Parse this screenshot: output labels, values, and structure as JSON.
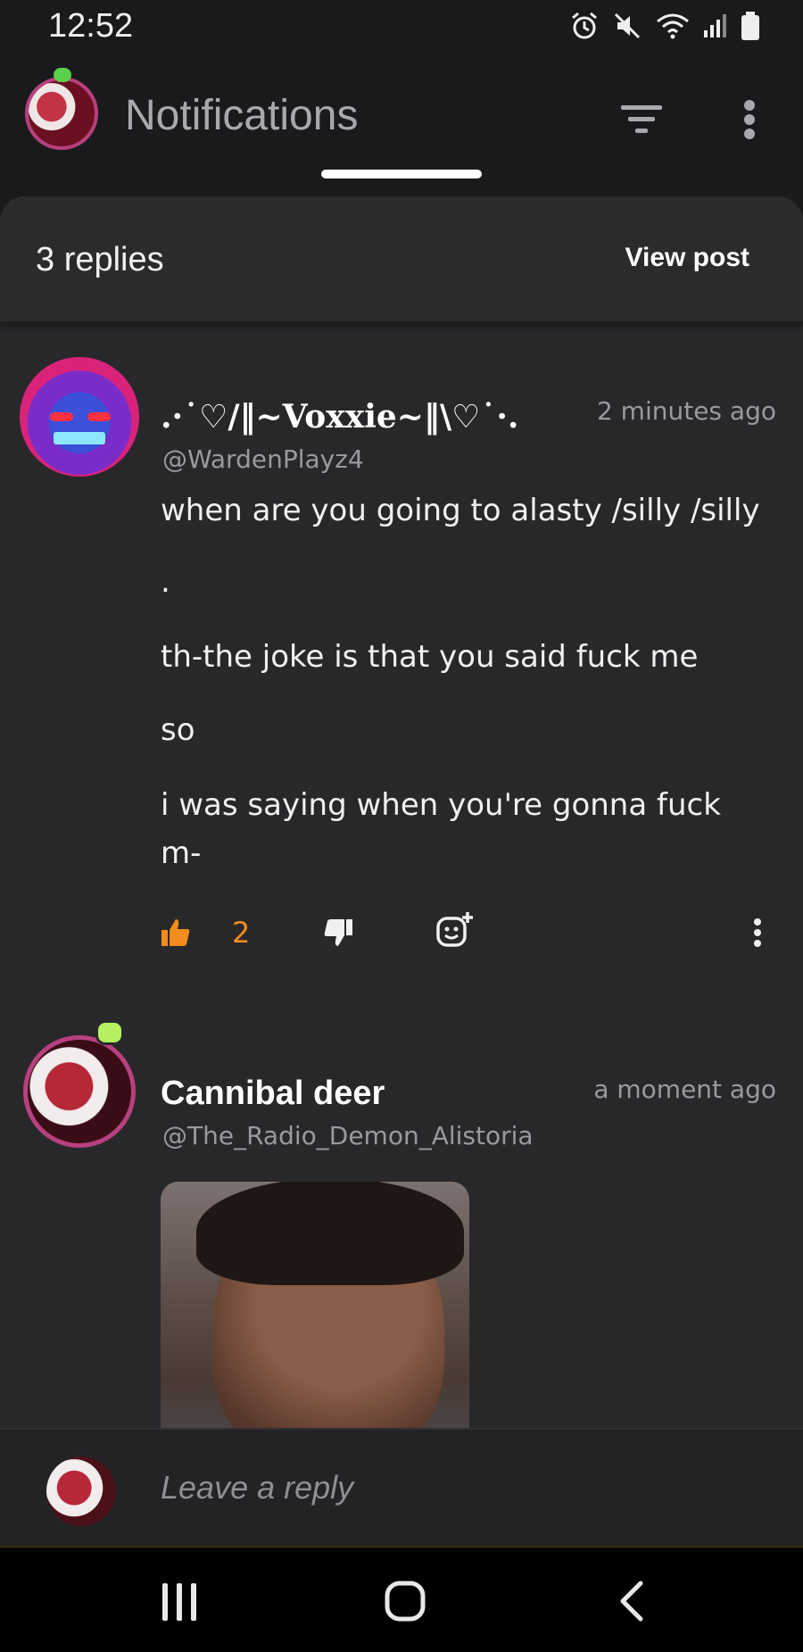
{
  "status_bar": {
    "time": "12:52",
    "icons": [
      "alarm-icon",
      "mute-icon",
      "wifi-icon",
      "signal-icon",
      "battery-icon"
    ]
  },
  "header": {
    "title": "Notifications",
    "icons": [
      "filter-icon",
      "more-vert-icon"
    ]
  },
  "thread": {
    "replies_label": "3 replies",
    "view_post_label": "View post"
  },
  "comments": [
    {
      "author": ".·˙♡/‖~Voxxie~‖\\♡˙·.",
      "handle": "@WardenPlayz4",
      "timestamp": "2 minutes ago",
      "lines": [
        "when are you going to alasty /silly /silly",
        ".",
        "th-the joke is that you said fuck me",
        "so",
        "i was saying when you're gonna fuck",
        "m-"
      ],
      "likes": "2"
    },
    {
      "author": "Cannibal deer",
      "handle": "@The_Radio_Demon_Alistoria",
      "timestamp": "a moment ago",
      "attachment": "gif-image"
    }
  ],
  "reply_input": {
    "placeholder": "Leave a reply"
  },
  "colors": {
    "background": "#1a1a1c",
    "panel": "#28282b",
    "like_accent": "#f28c1c",
    "avatar_ring": "#b8407f"
  }
}
